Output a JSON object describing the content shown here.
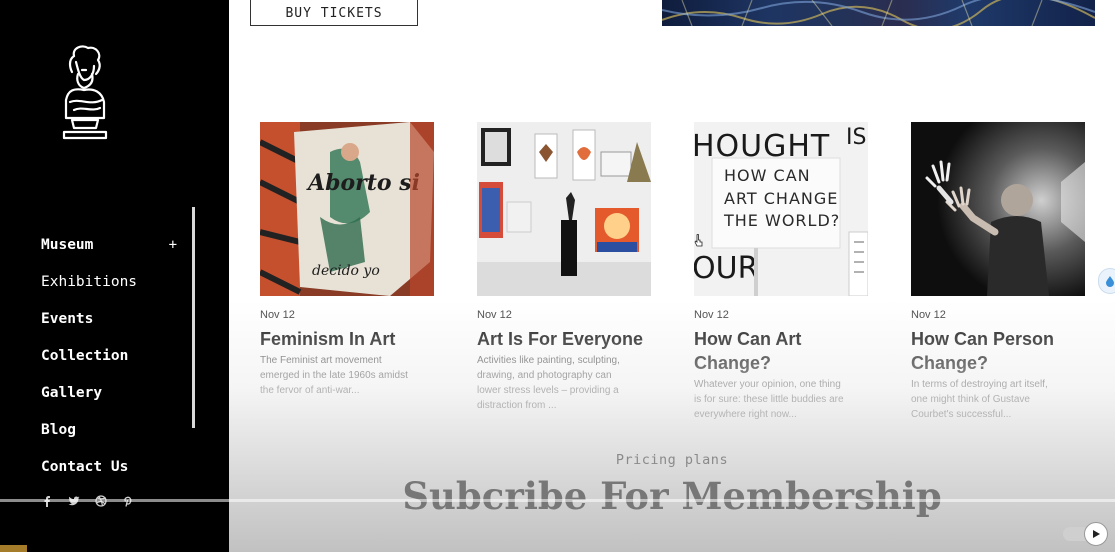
{
  "sidebar": {
    "logo_icon": "bust-statue-icon",
    "nav": [
      {
        "label": "Museum",
        "expand": "+",
        "bold": true
      },
      {
        "label": "Exhibitions",
        "bold": false
      },
      {
        "label": "Events",
        "bold": true
      },
      {
        "label": "Collection",
        "bold": true
      },
      {
        "label": "Gallery",
        "bold": true
      },
      {
        "label": "Blog",
        "bold": true
      },
      {
        "label": "Contact Us",
        "bold": true
      }
    ],
    "socials": [
      "facebook-icon",
      "twitter-icon",
      "dribbble-icon",
      "pinterest-icon"
    ]
  },
  "main": {
    "buy_tickets": "BUY TICKETS",
    "cards": [
      {
        "date": "Nov 12",
        "title": "Feminism In Art",
        "excerpt": "The Feminist art movement emerged in the late 1960s amidst the fervor of anti-war...",
        "image_text": [
          "Aborto si",
          "decido yo"
        ]
      },
      {
        "date": "Nov 12",
        "title": "Art Is For Everyone",
        "excerpt": "Activities like painting, sculpting, drawing, and photography can lower stress levels – providing a distraction from ..."
      },
      {
        "date": "Nov 12",
        "title": "How Can Art Change?",
        "excerpt": "Whatever your opinion, one thing is for sure: these little buddies are everywhere right now...",
        "image_text": [
          "HOUGHT",
          "IS",
          "HOW CAN",
          "ART CHANGE",
          "THE WORLD?",
          "OUR"
        ]
      },
      {
        "date": "Nov 12",
        "title": "How Can Person Change?",
        "excerpt": "In terms of destroying art itself, one might think of Gustave Courbet's successful..."
      }
    ],
    "pricing": {
      "kicker": "Pricing plans",
      "title": "Subcribe For Membership"
    }
  },
  "colors": {
    "sidebar_bg": "#000000",
    "text_dark": "#111111",
    "muted": "#8a8a8a"
  }
}
